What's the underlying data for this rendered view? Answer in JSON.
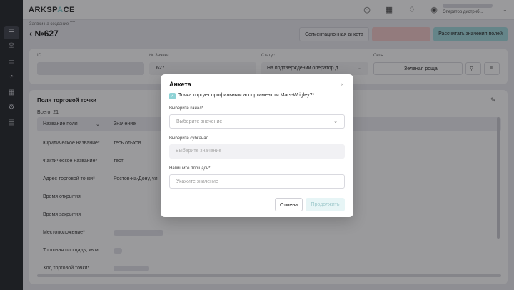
{
  "app": {
    "logo_main": "ARKSP",
    "logo_accent": "A",
    "logo_tail": "CE"
  },
  "header": {
    "user_role": "Оператор дистриб...",
    "icons": [
      "chat-icon",
      "grid-icon",
      "bell-icon",
      "compass-icon"
    ]
  },
  "nav_icons": [
    "menu-icon",
    "database-icon",
    "monitor-icon",
    "circle-icon",
    "calendar-icon",
    "settings-icon",
    "calendar-icon"
  ],
  "page": {
    "breadcrumb": "Заявки на создание ТТ",
    "title": "№627",
    "buttons": {
      "segment": "Сегментационная анкета",
      "calculate": "Рассчитать значения полей"
    }
  },
  "info": {
    "id_label": "ID",
    "order_label": "№ Заявки",
    "order_value": "627",
    "status_label": "Статус",
    "status_value": "На подтверждении оператор д...",
    "network_label": "Сеть",
    "network_value": "Зеленая роща"
  },
  "fields_card": {
    "title": "Поля торговой точки",
    "total": "Всего: 21",
    "columns": [
      "Название поля",
      "Значение"
    ],
    "rows": [
      {
        "name": "Юридическое название*",
        "value": "тесь ольхов"
      },
      {
        "name": "Фактическое название*",
        "value": "тест"
      },
      {
        "name": "Адрес торговой точки*",
        "value": "Ростов-на-Дону, ул."
      },
      {
        "name": "Время открытия",
        "value": ""
      },
      {
        "name": "Время закрытия",
        "value": ""
      },
      {
        "name": "Местоположение*",
        "value": ""
      },
      {
        "name": "Торговая площадь, кв.м.",
        "value": ""
      },
      {
        "name": "Ход торговой точки*",
        "value": ""
      }
    ]
  },
  "modal": {
    "title": "Анкета",
    "checkbox_label": "Точка торгует профильным ассортиментом Mars-Wrigley?*",
    "channel_label": "Выберите канал*",
    "channel_placeholder": "Выберите значение",
    "subchannel_label": "Выберите субканал",
    "subchannel_placeholder": "Выберите значение",
    "area_label": "Напишите площадь*",
    "area_placeholder": "Укажите значение",
    "cancel": "Отмена",
    "continue": "Продолжить"
  }
}
